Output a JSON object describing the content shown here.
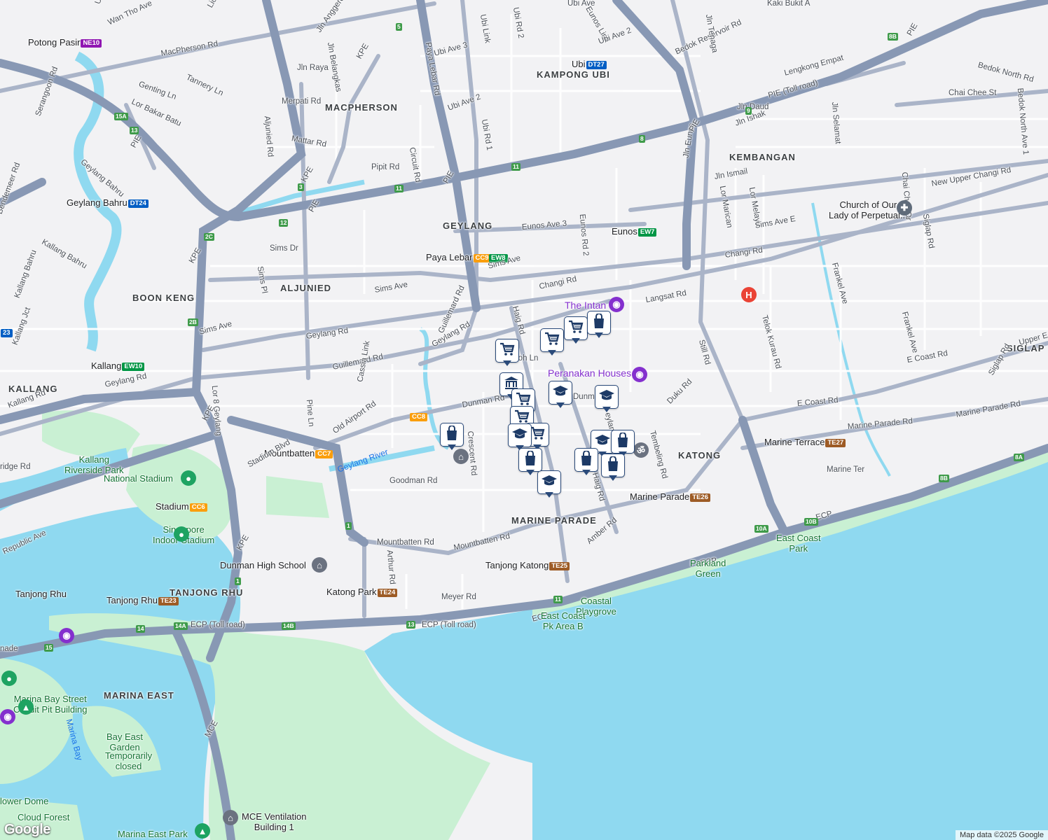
{
  "map": {
    "area_labels": [
      {
        "text": "KAMPONG UBI"
      },
      {
        "text": "MACPHERSON"
      },
      {
        "text": "KEMBANGAN"
      },
      {
        "text": "GEYLANG"
      },
      {
        "text": "ALJUNIED"
      },
      {
        "text": "BOON KENG"
      },
      {
        "text": "KALLANG"
      },
      {
        "text": "KATONG"
      },
      {
        "text": "SIGLAP"
      },
      {
        "text": "MARINE PARADE"
      },
      {
        "text": "TANJONG RHU"
      },
      {
        "text": "MARINA EAST"
      }
    ],
    "stations": [
      {
        "name": "Potong Pasir",
        "code": "NE10",
        "color": "#9016b2"
      },
      {
        "name": "Ubi",
        "code": "DT27",
        "color": "#005ec4"
      },
      {
        "name": "Geylang Bahru",
        "code": "DT24",
        "color": "#005ec4"
      },
      {
        "name": "Eunos",
        "code": "EW7",
        "color": "#009645"
      },
      {
        "name": "Paya Lebar",
        "code": "CC9",
        "color": "#fa9e0d"
      },
      {
        "name": "",
        "code": "EW8",
        "color": "#009645"
      },
      {
        "name": "Kallang",
        "code": "EW10",
        "color": "#009645"
      },
      {
        "name": "",
        "code": "CC8",
        "color": "#fa9e0d"
      },
      {
        "name": "Mountbatten",
        "code": "CC7",
        "color": "#fa9e0d"
      },
      {
        "name": "Stadium",
        "code": "CC6",
        "color": "#fa9e0d"
      },
      {
        "name": "Marine Terrace",
        "code": "TE27",
        "color": "#9d5b25"
      },
      {
        "name": "Marine Parade",
        "code": "TE26",
        "color": "#9d5b25"
      },
      {
        "name": "Tanjong Katong",
        "code": "TE25",
        "color": "#9d5b25"
      },
      {
        "name": "Katong Park",
        "code": "TE24",
        "color": "#9d5b25"
      },
      {
        "name": "Tanjong Rhu",
        "code": "TE23",
        "color": "#9d5b25"
      },
      {
        "name": "",
        "code": "23",
        "color": "#005ec4"
      }
    ],
    "roads": [
      {
        "text": "Lichi Ave"
      },
      {
        "text": "Wan Tho Ave"
      },
      {
        "text": "MacPherson Rd"
      },
      {
        "text": "Paya Lebar Rd"
      },
      {
        "text": "Ubi Link"
      },
      {
        "text": "Ubi Rd 2"
      },
      {
        "text": "Ubi Ave 3"
      },
      {
        "text": "Ubi Ave 2"
      },
      {
        "text": "Ubi Rd 1"
      },
      {
        "text": "Jln Anggerek"
      },
      {
        "text": "Jln Belangkas"
      },
      {
        "text": "Jln Raya"
      },
      {
        "text": "Merpati Rd"
      },
      {
        "text": "Mattar Rd"
      },
      {
        "text": "Pipit Rd"
      },
      {
        "text": "Circuit Rd"
      },
      {
        "text": "Aljunied Rd"
      },
      {
        "text": "Genting Ln"
      },
      {
        "text": "Lor Bakar Batu"
      },
      {
        "text": "Tannery Ln"
      },
      {
        "text": "Serangoon Rd"
      },
      {
        "text": "Geylang Bahru"
      },
      {
        "text": "Bendemeer Rd"
      },
      {
        "text": "Kallang Bahru"
      },
      {
        "text": "Kallang Jct"
      },
      {
        "text": "Sims Dr"
      },
      {
        "text": "Sims Pl"
      },
      {
        "text": "Sims Ave"
      },
      {
        "text": "Sims Ave"
      },
      {
        "text": "Sims Ave"
      },
      {
        "text": "Geylang Rd"
      },
      {
        "text": "Geylang Rd"
      },
      {
        "text": "Guillemard Rd"
      },
      {
        "text": "Guillemard Rd"
      },
      {
        "text": "Haig Rd"
      },
      {
        "text": "Changi Rd"
      },
      {
        "text": "Changi Rd"
      },
      {
        "text": "Langsat Rd"
      },
      {
        "text": "Eunos Ave 3"
      },
      {
        "text": "Eunos Rd 2"
      },
      {
        "text": "Jln Eunos"
      },
      {
        "text": "Jln Ismail"
      },
      {
        "text": "Lor Marican"
      },
      {
        "text": "Lor Melayu"
      },
      {
        "text": "Sims Ave E"
      },
      {
        "text": "Still Rd"
      },
      {
        "text": "Telok Kurau Rd"
      },
      {
        "text": "Frankel Ave"
      },
      {
        "text": "Frankel Ave"
      },
      {
        "text": "New Upper Changi Rd"
      },
      {
        "text": "Chai Chee St"
      },
      {
        "text": "Chai Chee Dr"
      },
      {
        "text": "Siglap Rd"
      },
      {
        "text": "Bedok North Rd"
      },
      {
        "text": "Bedok North Ave 1"
      },
      {
        "text": "Bedok Reservoir Rd"
      },
      {
        "text": "Lengkong Empat"
      },
      {
        "text": "Jln Selamat"
      },
      {
        "text": "Jln Daud"
      },
      {
        "text": "Jln Ishak"
      },
      {
        "text": "Jln Tenaga"
      },
      {
        "text": "Kaki Bukit A"
      },
      {
        "text": "Eunos Link"
      },
      {
        "text": "Ubi Ave 2"
      },
      {
        "text": "Ubi Ave"
      },
      {
        "text": "E Coast Rd"
      },
      {
        "text": "E Coast Rd"
      },
      {
        "text": "Marine Parade Rd"
      },
      {
        "text": "Marine Parade Rd"
      },
      {
        "text": "Marine Ter"
      },
      {
        "text": "Upper E"
      },
      {
        "text": "Siglap Rd"
      },
      {
        "text": "Duku Rd"
      },
      {
        "text": "Tembeling Rd"
      },
      {
        "text": "Dunman Rd"
      },
      {
        "text": "Old Airport Rd"
      },
      {
        "text": "Cassia Link"
      },
      {
        "text": "Crescent Rd"
      },
      {
        "text": "Pine Ln"
      },
      {
        "text": "Lor 8 Geylang"
      },
      {
        "text": "Goodman Rd"
      },
      {
        "text": "Mountbatten Rd"
      },
      {
        "text": "Mountbatten Rd"
      },
      {
        "text": "Arthur Rd"
      },
      {
        "text": "Meyer Rd"
      },
      {
        "text": "Amber Rd"
      },
      {
        "text": "Stadium Blvd"
      },
      {
        "text": "Republic Ave"
      },
      {
        "text": "Kallang Rd"
      },
      {
        "text": "Geylang Rd"
      },
      {
        "text": "Kallang Bahru"
      },
      {
        "text": "ECP (Toll road)"
      },
      {
        "text": "ECP (Toll road)"
      },
      {
        "text": "PIE (Toll road)"
      },
      {
        "text": "ECP"
      },
      {
        "text": "ECP"
      },
      {
        "text": "ECP"
      },
      {
        "text": "Upper S"
      },
      {
        "text": "Poh Ln"
      },
      {
        "text": "Dunm"
      },
      {
        "text": "eylan"
      },
      {
        "text": "Haig Rd"
      },
      {
        "text": "ridge Rd"
      },
      {
        "text": "nade"
      }
    ],
    "expressways": [
      {
        "text": "PIE"
      },
      {
        "text": "PIE"
      },
      {
        "text": "PIE"
      },
      {
        "text": "PIE"
      },
      {
        "text": "PIE"
      },
      {
        "text": "KPE"
      },
      {
        "text": "KPE"
      },
      {
        "text": "KPE"
      },
      {
        "text": "KPE"
      },
      {
        "text": "KPE"
      },
      {
        "text": "MCE"
      },
      {
        "text": "ECP"
      }
    ],
    "exit_numbers": [
      {
        "text": "5"
      },
      {
        "text": "8B"
      },
      {
        "text": "9"
      },
      {
        "text": "8"
      },
      {
        "text": "11"
      },
      {
        "text": "11"
      },
      {
        "text": "3"
      },
      {
        "text": "12"
      },
      {
        "text": "2C"
      },
      {
        "text": "15A"
      },
      {
        "text": "13"
      },
      {
        "text": "2B"
      },
      {
        "text": "1"
      },
      {
        "text": "14"
      },
      {
        "text": "14A"
      },
      {
        "text": "14B"
      },
      {
        "text": "13"
      },
      {
        "text": "11"
      },
      {
        "text": "10A"
      },
      {
        "text": "10B"
      },
      {
        "text": "8B"
      },
      {
        "text": "8A"
      },
      {
        "text": "15"
      },
      {
        "text": "1"
      }
    ],
    "places": [
      {
        "text": "The Intan",
        "kind": "poi"
      },
      {
        "text": "Peranakan Houses",
        "kind": "poi"
      },
      {
        "text": "Church of Our\nLady of Perpetual...",
        "kind": "place"
      },
      {
        "text": "National Stadium",
        "kind": "park"
      },
      {
        "text": "Singapore\nIndoor Stadium",
        "kind": "park"
      },
      {
        "text": "Dunman High School",
        "kind": "place"
      },
      {
        "text": "Kallang\nRiverside Park",
        "kind": "park"
      },
      {
        "text": "Parkland\nGreen",
        "kind": "park"
      },
      {
        "text": "East Coast\nPark",
        "kind": "park"
      },
      {
        "text": "Coastal\nPlaygrove",
        "kind": "park"
      },
      {
        "text": "East Coast\nPk Area B",
        "kind": "park"
      },
      {
        "text": "Marina Bay Street\nCircuit Pit Building",
        "kind": "park"
      },
      {
        "text": "Bay East\nGarden",
        "kind": "park"
      },
      {
        "text": "Temporarily\nclosed",
        "kind": "park"
      },
      {
        "text": "Marina Bay",
        "kind": "water"
      },
      {
        "text": "Geylang River",
        "kind": "water"
      },
      {
        "text": "lower Dome",
        "kind": "park"
      },
      {
        "text": "Cloud Forest",
        "kind": "park"
      },
      {
        "text": "MCE Ventilation\nBuilding 1",
        "kind": "place"
      },
      {
        "text": "Marina East Park",
        "kind": "park"
      },
      {
        "text": "Tanjong Rhu",
        "kind": "place"
      }
    ],
    "markers": [
      {
        "icon": "shopping-cart-icon"
      },
      {
        "icon": "shopping-cart-icon"
      },
      {
        "icon": "shopping-cart-icon"
      },
      {
        "icon": "shopping-bag-icon"
      },
      {
        "icon": "shopping-bag-icon"
      },
      {
        "icon": "graduation-cap-icon"
      },
      {
        "icon": "graduation-cap-icon"
      },
      {
        "icon": "bank-icon"
      },
      {
        "icon": "shopping-cart-icon"
      },
      {
        "icon": "shopping-cart-icon"
      },
      {
        "icon": "shopping-cart-icon"
      },
      {
        "icon": "graduation-cap-icon"
      },
      {
        "icon": "graduation-cap-icon"
      },
      {
        "icon": "shopping-bag-icon"
      },
      {
        "icon": "shopping-bag-icon"
      },
      {
        "icon": "shopping-bag-icon"
      },
      {
        "icon": "graduation-cap-icon"
      },
      {
        "icon": "shopping-bag-icon"
      }
    ],
    "credit": "Map data ©2025 Google",
    "logo": "Google",
    "colors": {
      "sea": "#8fd9f0",
      "park": "#c9f0d3",
      "road": "#aab4c8",
      "highway": "#8898b4",
      "land": "#f2f2f4",
      "marker": "#1d3a66"
    }
  }
}
